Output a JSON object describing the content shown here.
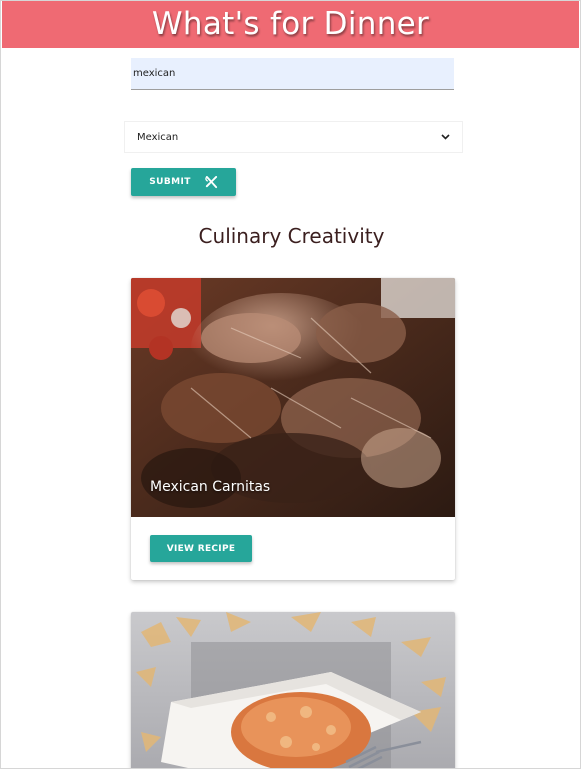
{
  "header": {
    "title": "What's for Dinner"
  },
  "search": {
    "value": "mexican"
  },
  "cuisine_select": {
    "selected": "Mexican",
    "chevron_icon": "chevron-down-icon"
  },
  "submit_button": {
    "label": "SUBMIT",
    "icon": "utensils-icon"
  },
  "section": {
    "title": "Culinary Creativity"
  },
  "recipes": [
    {
      "title": "Mexican Carnitas",
      "button_label": "VIEW RECIPE"
    },
    {
      "title": "",
      "button_label": ""
    }
  ],
  "colors": {
    "header_bg": "#ef6a73",
    "accent": "#26a69a",
    "input_bg": "#e8f0fe"
  }
}
